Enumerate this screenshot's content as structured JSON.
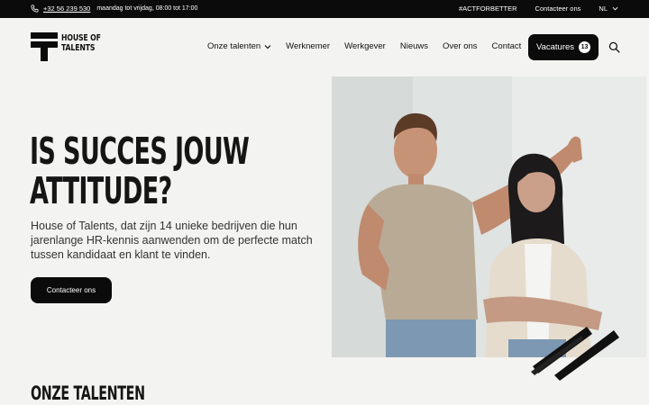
{
  "topbar": {
    "phone": "+32 56 239 530",
    "hours": "maandag tot vrijdag, 08:00 tot 17:00",
    "hashtag": "#ACTFORBETTER",
    "contact": "Contacteer ons",
    "language": "NL"
  },
  "logo": {
    "line1": "HOUSE OF",
    "line2": "TALENTS"
  },
  "nav": {
    "items": [
      "Onze talenten",
      "Werknemer",
      "Werkgever",
      "Nieuws",
      "Over ons",
      "Contact"
    ],
    "vacatures_label": "Vacatures",
    "vacatures_count": "13"
  },
  "hero": {
    "title_line1": "IS SUCCES JOUW",
    "title_line2": "ATTITUDE?",
    "text": "House of Talents, dat zijn 14 unieke bedrijven die hun jarenlange HR-kennis aanwenden om de perfecte match tussen kandidaat en klant te vinden.",
    "cta": "Contacteer ons"
  },
  "section": {
    "title": "ONZE TALENTEN"
  },
  "icons": {
    "phone": "phone-icon",
    "search": "search-icon",
    "chevron": "chevron-down-icon"
  },
  "colors": {
    "background": "#f3f3f1",
    "dark": "#0b0b0b",
    "white": "#ffffff"
  }
}
